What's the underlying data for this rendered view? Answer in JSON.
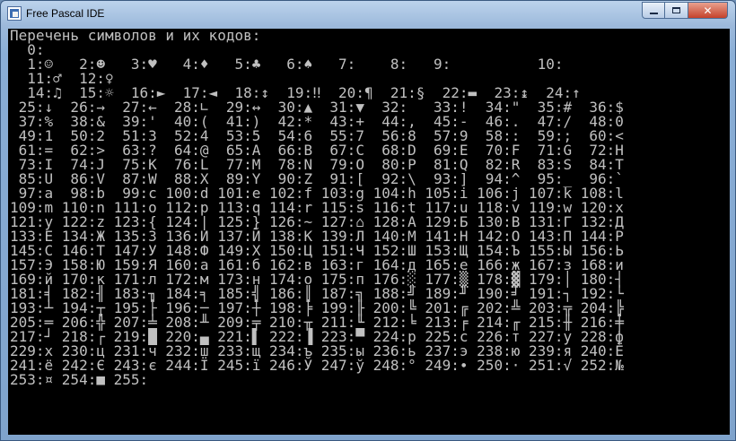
{
  "window": {
    "title": "Free Pascal IDE"
  },
  "caption_buttons": {
    "minimize": "minimize",
    "maximize": "maximize",
    "close": "✕"
  },
  "console": {
    "lines": [
      "Перечень символов и их кодов:",
      "  0:",
      "  1:☺   2:☻   3:♥   4:♦   5:♣   6:♠   7:    8:   9:          10:",
      "  11:♂  12:♀",
      "  14:♫  15:☼  16:►  17:◄  18:↕  19:‼  20:¶  21:§  22:▬  23:↨  24:↑",
      " 25:↓  26:→  27:←  28:∟  29:↔  30:▲  31:▼  32:   33:!  34:\"  35:#  36:$",
      " 37:%  38:&  39:'  40:(  41:)  42:*  43:+  44:,  45:-  46:.  47:/  48:0",
      " 49:1  50:2  51:3  52:4  53:5  54:6  55:7  56:8  57:9  58::  59:;  60:<",
      " 61:=  62:>  63:?  64:@  65:A  66:B  67:C  68:D  69:E  70:F  71:G  72:H",
      " 73:I  74:J  75:K  76:L  77:M  78:N  79:O  80:P  81:Q  82:R  83:S  84:T",
      " 85:U  86:V  87:W  88:X  89:Y  90:Z  91:[  92:\\  93:]  94:^  95:_  96:`",
      " 97:a  98:b  99:c 100:d 101:e 102:f 103:g 104:h 105:i 106:j 107:k 108:l",
      "109:m 110:n 111:o 112:p 113:q 114:r 115:s 116:t 117:u 118:v 119:w 120:x",
      "121:y 122:z 123:{ 124:| 125:} 126:~ 127:⌂ 128:А 129:Б 130:В 131:Г 132:Д",
      "133:Е 134:Ж 135:З 136:И 137:Й 138:К 139:Л 140:М 141:Н 142:О 143:П 144:Р",
      "145:С 146:Т 147:У 148:Ф 149:Х 150:Ц 151:Ч 152:Ш 153:Щ 154:Ъ 155:Ы 156:Ь",
      "157:Э 158:Ю 159:Я 160:а 161:б 162:в 163:г 164:д 165:е 166:ж 167:з 168:и",
      "169:й 170:к 171:л 172:м 173:н 174:о 175:п 176:░ 177:▒ 178:▓ 179:│ 180:┤",
      "181:╡ 182:╢ 183:╖ 184:╕ 185:╣ 186:║ 187:╗ 188:╝ 189:╜ 190:╛ 191:┐ 192:└",
      "193:┴ 194:┬ 195:├ 196:─ 197:┼ 198:╞ 199:╟ 200:╚ 201:╔ 202:╩ 203:╦ 204:╠",
      "205:═ 206:╬ 207:╧ 208:╨ 209:╤ 210:╥ 211:╙ 212:╘ 213:╒ 214:╓ 215:╫ 216:╪",
      "217:┘ 218:┌ 219:█ 220:▄ 221:▌ 222:▐ 223:▀ 224:р 225:с 226:т 227:у 228:ф",
      "229:х 230:ц 231:ч 232:ш 233:щ 234:ъ 235:ы 236:ь 237:э 238:ю 239:я 240:Ё",
      "241:ё 242:Є 243:є 244:Ї 245:ї 246:Ў 247:ў 248:° 249:∙ 250:· 251:√ 252:№",
      "253:¤ 254:■ 255:"
    ]
  }
}
